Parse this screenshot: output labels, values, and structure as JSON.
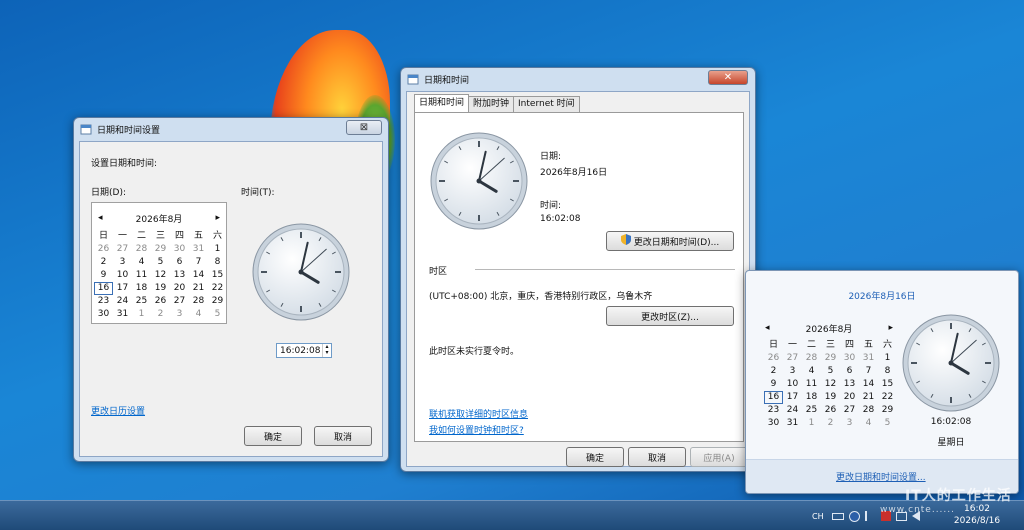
{
  "desktop": {},
  "dialog_settings": {
    "title": "日期和时间设置",
    "close_label": "⊠",
    "heading": "设置日期和时间:",
    "date_label": "日期(D):",
    "time_label": "时间(T):",
    "calendar": {
      "prev": "◂",
      "month": "2026年8月",
      "next": "▸",
      "weekdays": [
        "日",
        "一",
        "二",
        "三",
        "四",
        "五",
        "六"
      ],
      "days": [
        "26",
        "27",
        "28",
        "29",
        "30",
        "31",
        "1",
        "2",
        "3",
        "4",
        "5",
        "6",
        "7",
        "8",
        "9",
        "10",
        "11",
        "12",
        "13",
        "14",
        "15",
        "16",
        "17",
        "18",
        "19",
        "20",
        "21",
        "22",
        "23",
        "24",
        "25",
        "26",
        "27",
        "28",
        "29",
        "30",
        "31",
        "1",
        "2",
        "3",
        "4",
        "5"
      ],
      "selected_day": "16"
    },
    "clock": {
      "hour": 16,
      "minute": 2,
      "second": 8
    },
    "time_value": "16:02:08",
    "calendar_link": "更改日历设置",
    "ok": "确定",
    "cancel": "取消"
  },
  "dialog_main": {
    "title": "日期和时间",
    "close_label": "✕",
    "tabs": [
      "日期和时间",
      "附加时钟",
      "Internet 时间"
    ],
    "date_label": "日期:",
    "date_value": "2026年8月16日",
    "time_label": "时间:",
    "time_value": "16:02:08",
    "change_datetime_button": "更改日期和时间(D)...",
    "timezone_header": "时区",
    "timezone_value": "(UTC+08:00) 北京，重庆，香港特别行政区，乌鲁木齐",
    "change_timezone_button": "更改时区(Z)...",
    "dst_note": "此时区未实行夏令时。",
    "link_tz_info": "联机获取详细的时区信息",
    "link_how_to": "我如何设置时钟和时区?",
    "ok": "确定",
    "cancel": "取消",
    "apply": "应用(A)"
  },
  "flyout": {
    "date_heading": "2026年8月16日",
    "calendar": {
      "prev": "◂",
      "month": "2026年8月",
      "next": "▸",
      "weekdays": [
        "日",
        "一",
        "二",
        "三",
        "四",
        "五",
        "六"
      ],
      "days": [
        "26",
        "27",
        "28",
        "29",
        "30",
        "31",
        "1",
        "2",
        "3",
        "4",
        "5",
        "6",
        "7",
        "8",
        "9",
        "10",
        "11",
        "12",
        "13",
        "14",
        "15",
        "16",
        "17",
        "18",
        "19",
        "20",
        "21",
        "22",
        "23",
        "24",
        "25",
        "26",
        "27",
        "28",
        "29",
        "30",
        "31",
        "1",
        "2",
        "3",
        "4",
        "5"
      ],
      "selected_day": "16"
    },
    "time_value": "16:02:08",
    "weekday": "星期日",
    "settings_link": "更改日期和时间设置..."
  },
  "taskbar": {
    "ime": "CH",
    "time": "16:02",
    "date": "2026/8/16",
    "watermark": "IT人的工作生活",
    "watermark_sub": "www.cnte......"
  }
}
